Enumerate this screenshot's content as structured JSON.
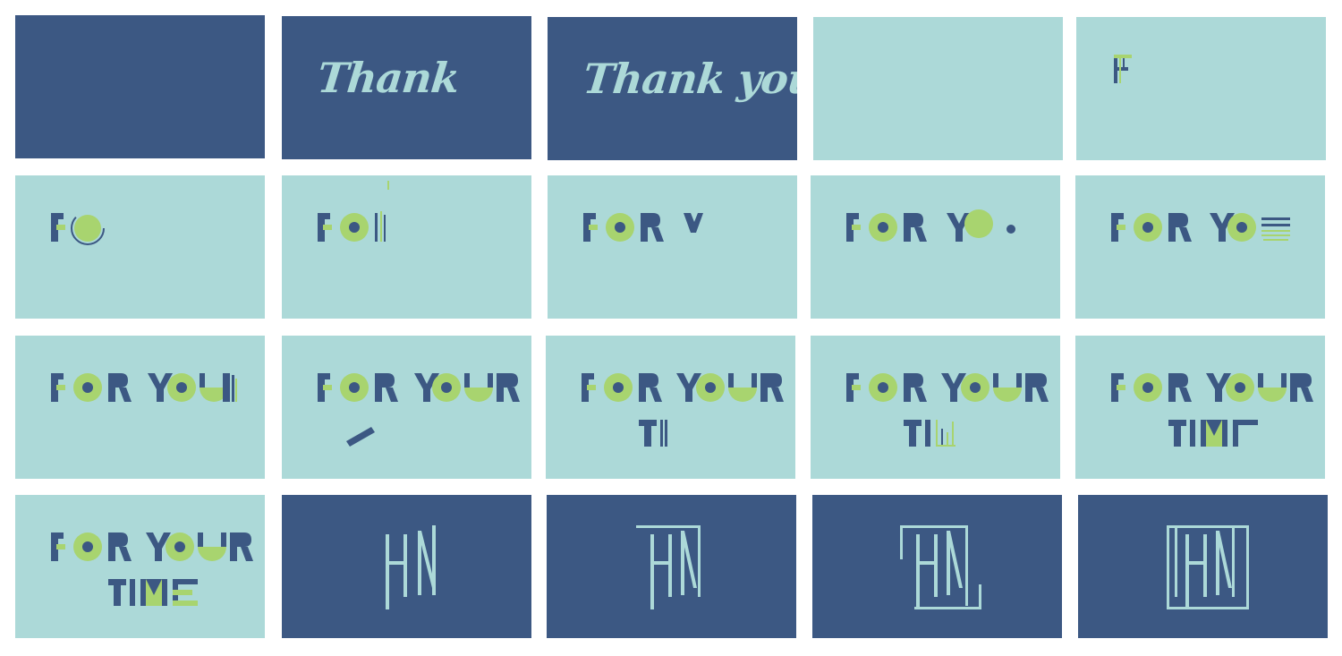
{
  "thank_words": {
    "first": "Thank",
    "full": "Thank you"
  },
  "colors": {
    "navy": "#3c5883",
    "mint": "#acd9d8",
    "green": "#a8d46f",
    "white": "#ffffff"
  }
}
